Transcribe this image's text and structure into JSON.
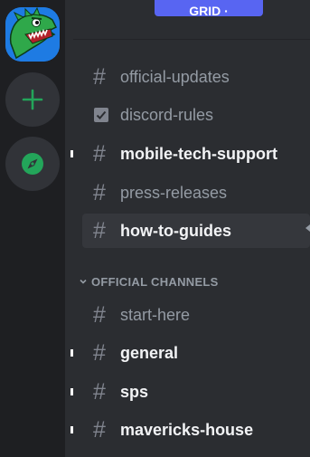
{
  "header": {
    "button_label": "GRID · "
  },
  "rail": {
    "server_icon": "dinosaur-server-avatar",
    "add_icon": "plus-icon",
    "explore_icon": "compass-icon",
    "accent_green": "#23a55a"
  },
  "channels": {
    "top": [
      {
        "name": "official-updates",
        "icon": "hash-icon",
        "unread": false
      },
      {
        "name": "discord-rules",
        "icon": "rules-checkbox-icon",
        "unread": false
      },
      {
        "name": "mobile-tech-support",
        "icon": "hash-icon",
        "unread": true
      },
      {
        "name": "press-releases",
        "icon": "hash-icon",
        "unread": false
      },
      {
        "name": "how-to-guides",
        "icon": "hash-icon",
        "unread": false,
        "selected": true
      }
    ],
    "category": {
      "label": "OFFICIAL CHANNELS",
      "items": [
        {
          "name": "start-here",
          "icon": "hash-icon",
          "unread": false
        },
        {
          "name": "general",
          "icon": "hash-icon",
          "unread": true
        },
        {
          "name": "sps",
          "icon": "hash-icon",
          "unread": true
        },
        {
          "name": "mavericks-house",
          "icon": "hash-icon",
          "unread": true
        }
      ]
    }
  },
  "glyphs": {
    "hash": "#"
  }
}
